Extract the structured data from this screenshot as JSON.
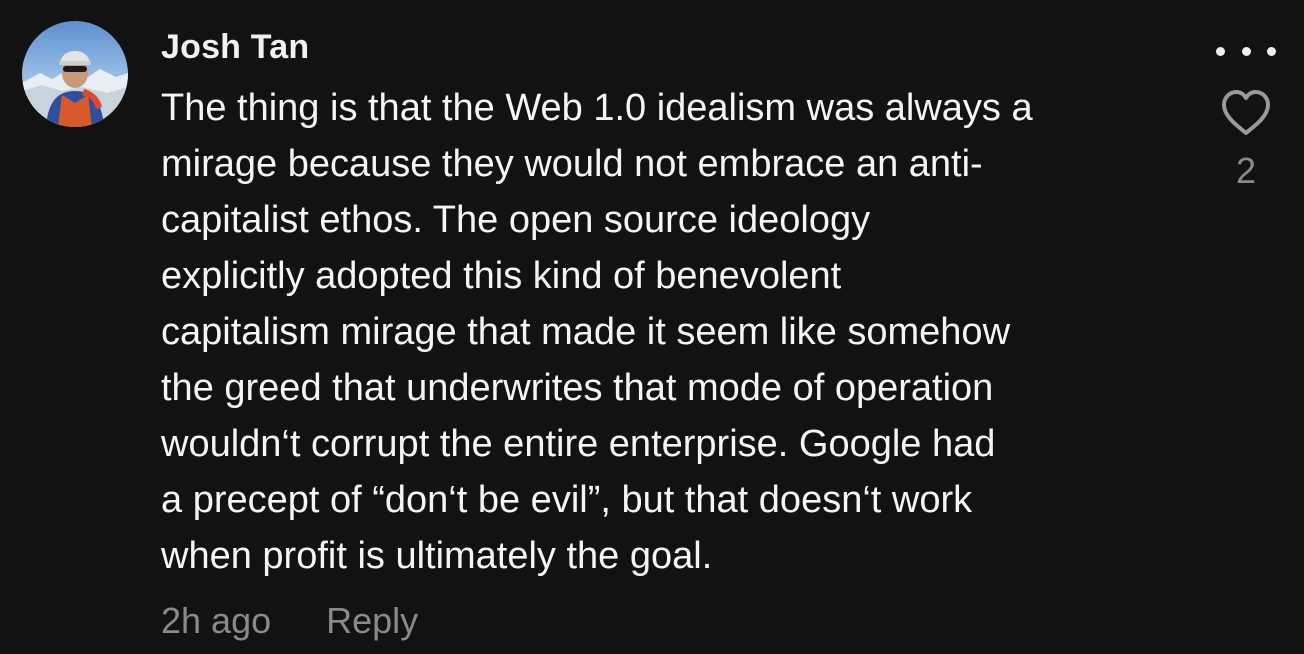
{
  "comment": {
    "author": "Josh Tan",
    "body_lines": [
      "The thing is that the Web 1.0 idealism was always a",
      "mirage because they would not embrace an anti-",
      "capitalist ethos. The open source ideology",
      "explicitly adopted this kind of benevolent",
      "capitalism mirage that made it seem like somehow",
      "the greed that underwrites that mode of operation",
      "wouldn‘t corrupt the entire enterprise. Google had",
      "a precept of “don‘t be evil”, but that doesn‘t work",
      "when profit is ultimately the goal."
    ],
    "timestamp": "2h ago",
    "reply_label": "Reply",
    "like_count": "2"
  },
  "icons": {
    "more": "more-horizontal-icon",
    "like": "heart-outline-icon"
  },
  "colors": {
    "background": "#121212",
    "text": "#f5f5f5",
    "muted": "#8a8a8a"
  }
}
